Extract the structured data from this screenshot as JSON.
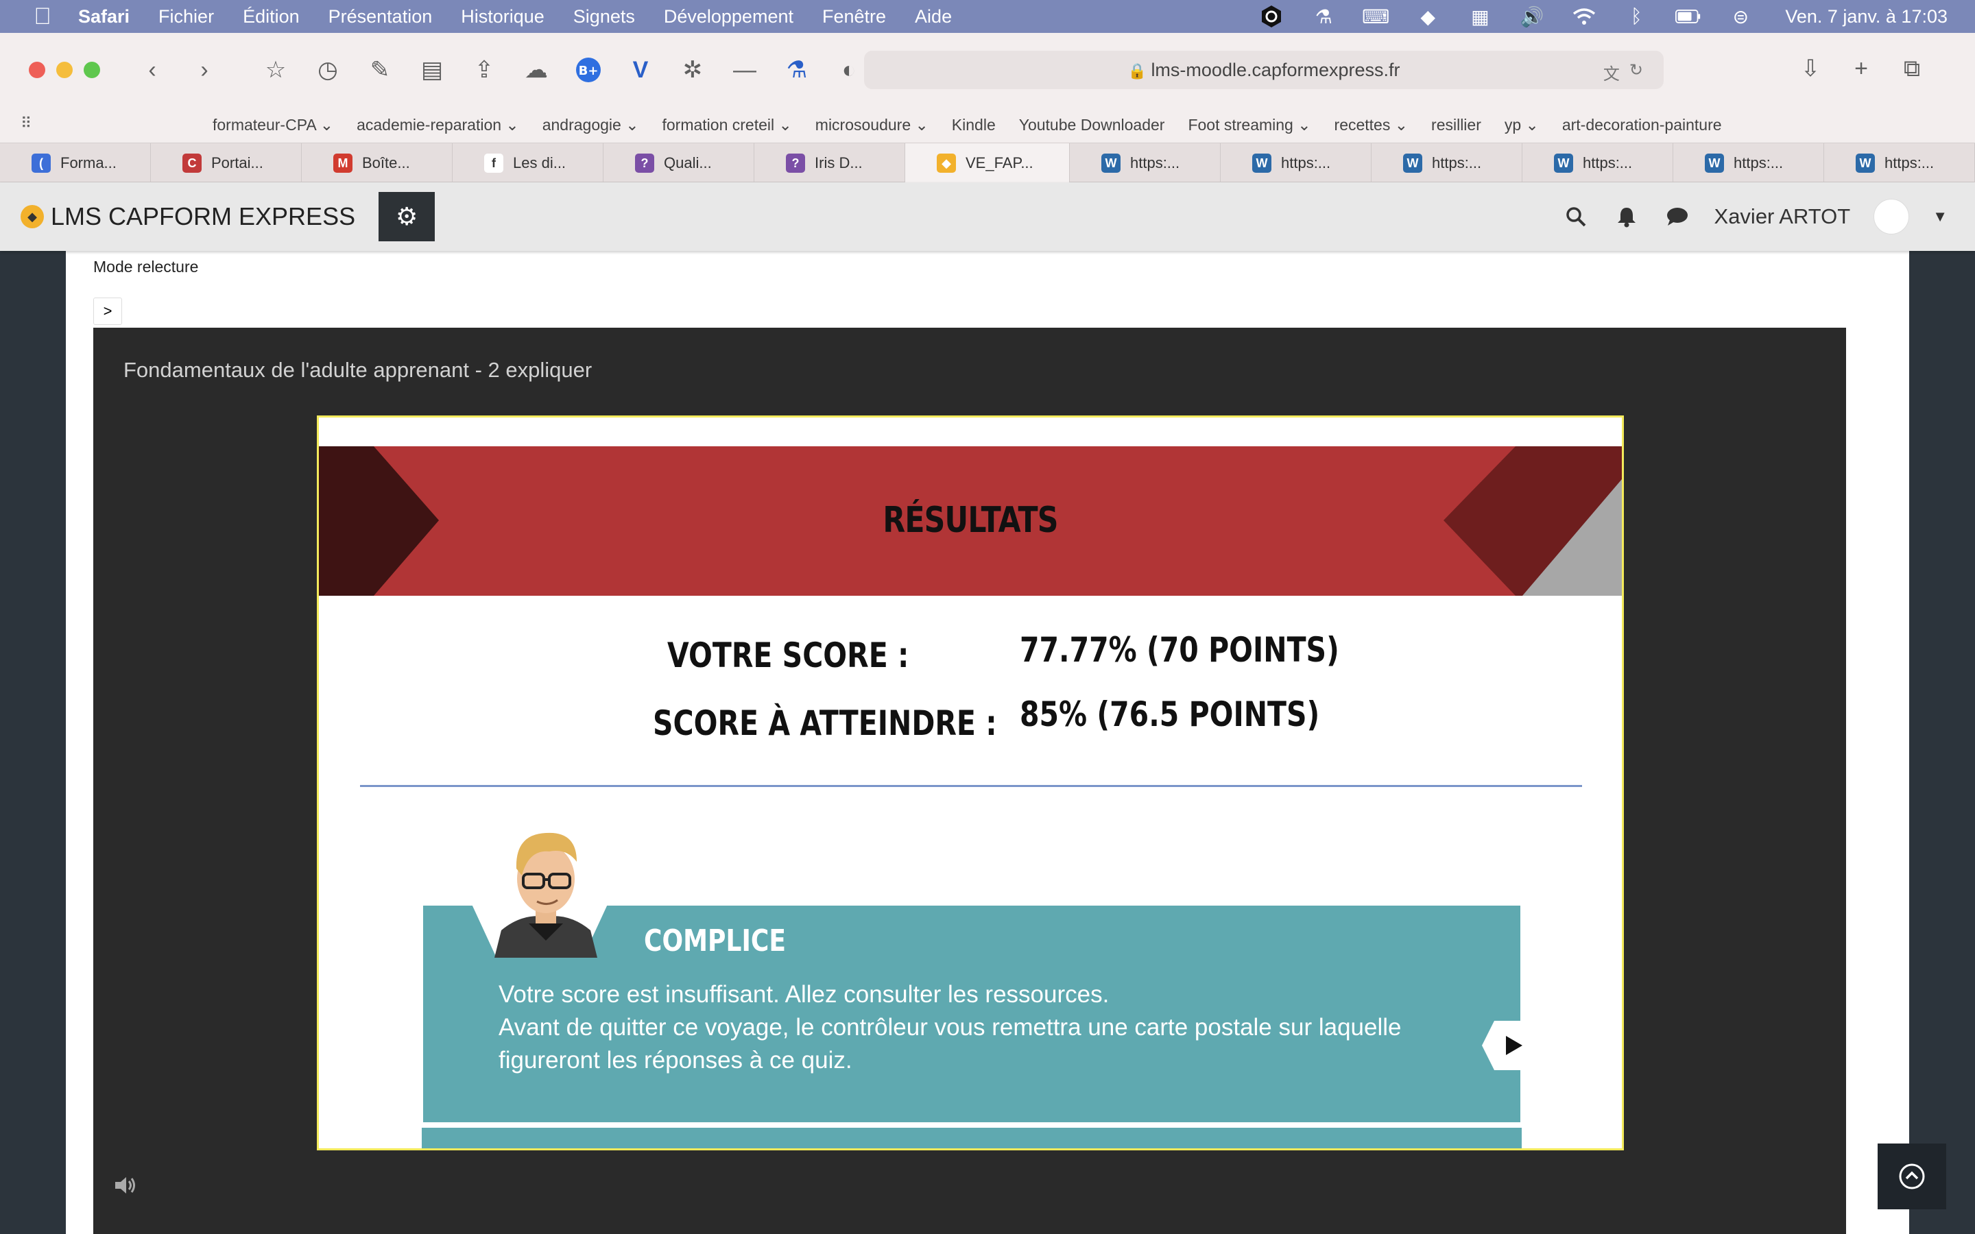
{
  "menubar": {
    "items": [
      "Safari",
      "Fichier",
      "Édition",
      "Présentation",
      "Historique",
      "Signets",
      "Développement",
      "Fenêtre",
      "Aide"
    ],
    "clock": "Ven. 7 janv. à  17:03"
  },
  "browser": {
    "url": "lms-moodle.capformexpress.fr",
    "favorites": [
      "formateur-CPA",
      "academie-reparation",
      "andragogie",
      "formation creteil",
      "microsoudure",
      "Kindle",
      "Youtube Downloader",
      "Foot streaming",
      "recettes",
      "resillier",
      "yp",
      "art-decoration-painture"
    ],
    "tabs": [
      {
        "label": "Forma...",
        "icon_color": "#3d6fd8",
        "glyph": "("
      },
      {
        "label": "Portai...",
        "icon_color": "#c23a3a",
        "glyph": "C"
      },
      {
        "label": "Boîte...",
        "icon_color": "#d13b2f",
        "glyph": "M"
      },
      {
        "label": "Les di...",
        "icon_color": "#ffffff",
        "glyph": "f"
      },
      {
        "label": "Quali...",
        "icon_color": "#7b4fa6",
        "glyph": "?"
      },
      {
        "label": "Iris D...",
        "icon_color": "#7b4fa6",
        "glyph": "?"
      },
      {
        "label": "VE_FAP...",
        "icon_color": "#f2b12c",
        "glyph": "◆"
      },
      {
        "label": "https:...",
        "icon_color": "#2c6aa8",
        "glyph": "W"
      },
      {
        "label": "https:...",
        "icon_color": "#2c6aa8",
        "glyph": "W"
      },
      {
        "label": "https:...",
        "icon_color": "#2c6aa8",
        "glyph": "W"
      },
      {
        "label": "https:...",
        "icon_color": "#2c6aa8",
        "glyph": "W"
      },
      {
        "label": "https:...",
        "icon_color": "#2c6aa8",
        "glyph": "W"
      },
      {
        "label": "https:...",
        "icon_color": "#2c6aa8",
        "glyph": "W"
      }
    ]
  },
  "site": {
    "brand": "LMS CAPFORM EXPRESS",
    "user_name": "Xavier ARTOT"
  },
  "page": {
    "mode_label": "Mode relecture",
    "nav_button": ">",
    "player_title": "Fondamentaux de l'adulte apprenant - 2 expliquer"
  },
  "slide": {
    "banner_title": "RÉSULTATS",
    "your_score_label": "VOTRE SCORE :",
    "your_score_value": "77.77% (70 POINTS)",
    "target_label": "SCORE À ATTEINDRE :",
    "target_value": "85% (76.5 POINTS)",
    "character_name": "COMPLICE",
    "message_lines": [
      "Votre score est insuffisant. Allez consulter les ressources.",
      "Avant de quitter ce voyage, le contrôleur vous remettra une carte postale sur laquelle",
      "figureront les réponses à ce quiz."
    ]
  },
  "colors": {
    "banner_red": "#b13536",
    "panel_teal": "#5fa9b0",
    "slide_border": "#f3ea5b",
    "player_bg": "#2a2a2a"
  }
}
